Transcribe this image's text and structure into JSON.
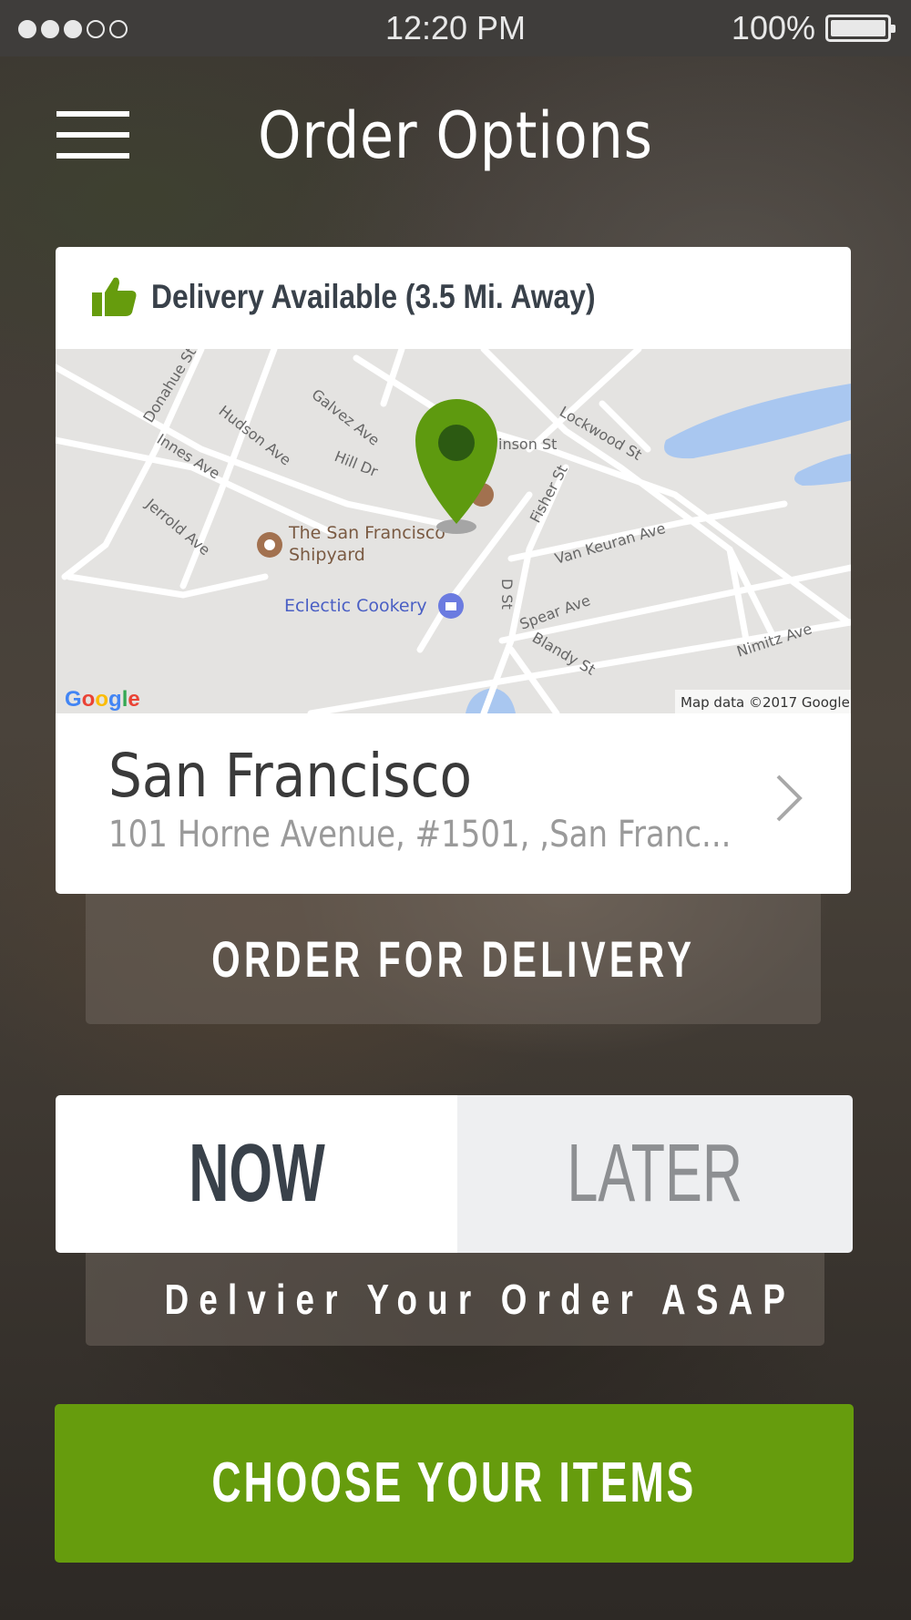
{
  "status_bar": {
    "time": "12:20 PM",
    "battery_percent": "100%",
    "signal_strength": 3,
    "signal_max": 5
  },
  "header": {
    "title": "Order Options",
    "menu_icon": "hamburger-menu-icon"
  },
  "delivery_card": {
    "status_icon": "thumbs-up-icon",
    "status_text": "Delivery Available (3.5 Mi. Away)",
    "map": {
      "streets": [
        "Donahue St",
        "Galvez Ave",
        "Hudson Ave",
        "Innes Ave",
        "Hill Dr",
        "Jerrold Ave",
        "Lockwood St",
        "inson St",
        "Fisher St",
        "Van Keuran Ave",
        "D St",
        "Spear Ave",
        "Blandy St",
        "Nimitz Ave"
      ],
      "places": [
        "The San Francisco Shipyard",
        "Eclectic Cookery"
      ],
      "logo": "Google",
      "attribution": "Map data ©2017 Google"
    },
    "location_name": "San Francisco",
    "location_address": "101 Horne Avenue, #1501, ,San Franc..."
  },
  "order_delivery_label": "ORDER FOR DELIVERY",
  "timing": {
    "now_label": "NOW",
    "later_label": "LATER",
    "selected": "NOW",
    "description": "Delvier Your Order ASAP"
  },
  "choose_items_label": "CHOOSE YOUR ITEMS",
  "colors": {
    "accent_green": "#669c0d",
    "pin_green": "#5e9a0f",
    "dark_text": "#39414a",
    "muted_text": "#9a9a9a"
  }
}
